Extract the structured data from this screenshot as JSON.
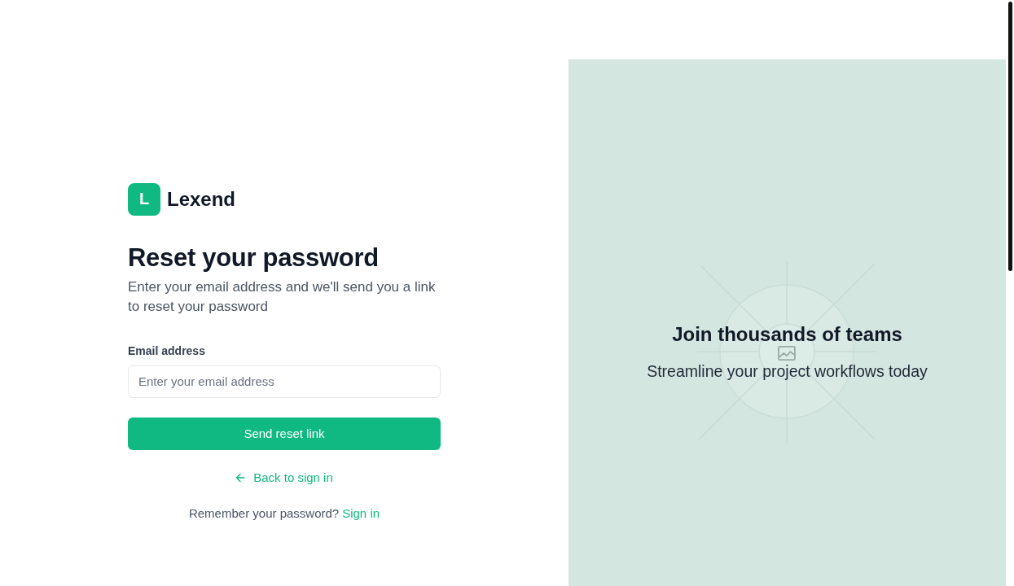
{
  "logo": {
    "mark": "L",
    "name": "Lexend"
  },
  "heading": "Reset your password",
  "subtitle": "Enter your email address and we'll send you a link to reset your password",
  "form": {
    "email": {
      "label": "Email address",
      "placeholder": "Enter your email address"
    },
    "submit": "Send reset link"
  },
  "back_link": "Back to sign in",
  "footer": {
    "text": "Remember your password?",
    "link": "Sign in"
  },
  "promo": {
    "title": "Join thousands of teams",
    "subtitle": "Streamline your project workflows today"
  }
}
